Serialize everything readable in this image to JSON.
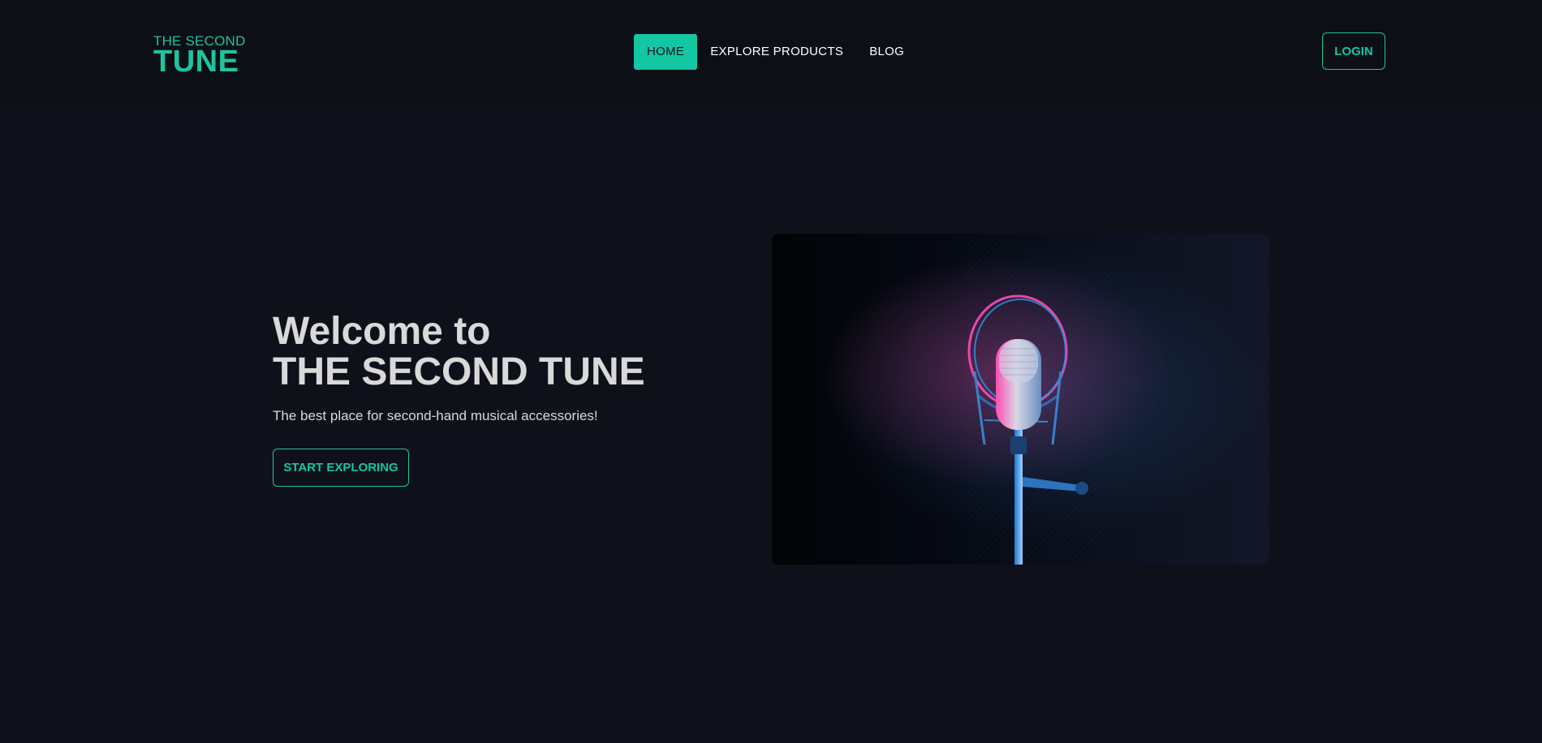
{
  "header": {
    "logo": {
      "line1": "THE SECOND",
      "line2": "TUNE"
    },
    "nav": [
      {
        "label": "HOME",
        "active": true
      },
      {
        "label": "EXPLORE PRODUCTS",
        "active": false
      },
      {
        "label": "BLOG",
        "active": false
      }
    ],
    "login_label": "LOGIN"
  },
  "hero": {
    "title_line1": "Welcome to",
    "title_line2": "THE SECOND TUNE",
    "subtitle": "The best place for second-hand musical accessories!",
    "cta_label": "START EXPLORING",
    "image_icon": "microphone-image"
  },
  "colors": {
    "background": "#0f111a",
    "header_background": "#0d0f16",
    "accent": "#14c7a3",
    "hero_text": "#d9d9d9"
  }
}
